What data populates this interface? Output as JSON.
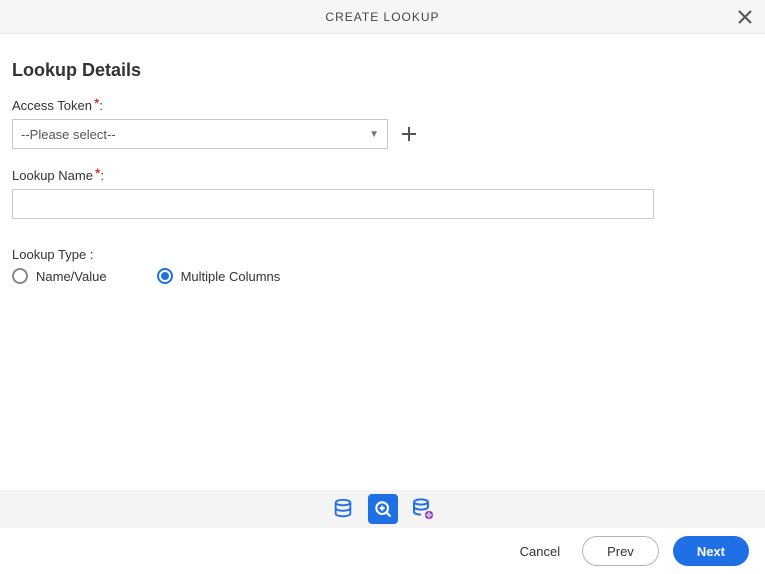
{
  "titlebar": {
    "title": "CREATE LOOKUP"
  },
  "section": {
    "heading": "Lookup Details"
  },
  "fields": {
    "access_token": {
      "label": "Access Token",
      "required_mark": "*",
      "colon": ":",
      "selected": "--Please select--"
    },
    "lookup_name": {
      "label": "Lookup Name",
      "required_mark": "*",
      "colon": ":",
      "value": ""
    },
    "lookup_type": {
      "label": "Lookup Type",
      "colon": ":",
      "options": {
        "name_value": "Name/Value",
        "multiple_columns": "Multiple Columns"
      },
      "selected": "multiple_columns"
    }
  },
  "footer": {
    "cancel": "Cancel",
    "prev": "Prev",
    "next": "Next"
  },
  "colors": {
    "accent": "#1f6fe5",
    "required": "#d40000",
    "gear_badge": "#8a3fb8"
  }
}
